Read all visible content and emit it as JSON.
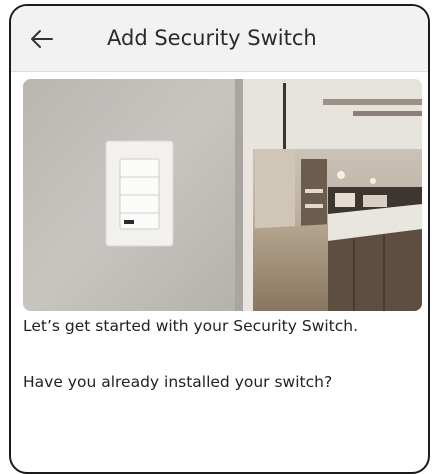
{
  "header": {
    "title": "Add Security Switch",
    "back_icon": "arrow-left-icon"
  },
  "hero": {
    "description": "Wall-mounted security switch beside a modern kitchen"
  },
  "content": {
    "intro": "Let’s get started with your Security Switch.",
    "question": "Have you already installed your switch?"
  },
  "colors": {
    "header_bg": "#f2f2f2",
    "frame_border": "#1b1b1b",
    "text": "#222222"
  }
}
